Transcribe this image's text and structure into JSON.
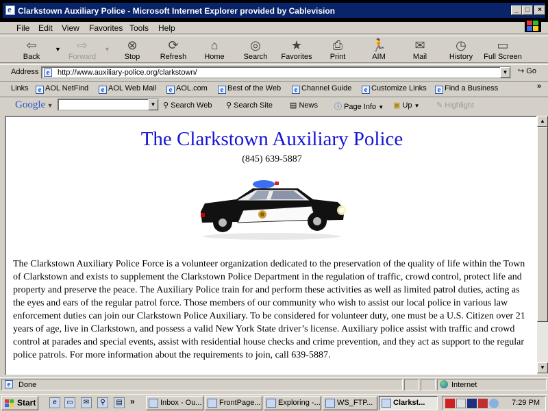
{
  "window": {
    "title": "Clarkstown Auxiliary Police - Microsoft Internet Explorer provided by Cablevision"
  },
  "menu": {
    "items": [
      "File",
      "Edit",
      "View",
      "Favorites",
      "Tools",
      "Help"
    ]
  },
  "toolbar": {
    "buttons": [
      "Back",
      "Forward",
      "Stop",
      "Refresh",
      "Home",
      "Search",
      "Favorites",
      "Print",
      "AIM",
      "Mail",
      "History",
      "Full Screen"
    ]
  },
  "address": {
    "label": "Address",
    "url": "http://www.auxiliary-police.org/clarkstown/",
    "go_label": "Go"
  },
  "links": {
    "label": "Links",
    "items": [
      "AOL NetFind",
      "AOL Web Mail",
      "AOL.com",
      "Best of the Web",
      "Channel Guide",
      "Customize Links",
      "Find a Business"
    ]
  },
  "google_bar": {
    "logo": "Google",
    "search_web": "Search Web",
    "search_site": "Search Site",
    "news": "News",
    "page_info": "Page Info",
    "up": "Up",
    "highlight": "Highlight"
  },
  "page": {
    "heading": "The Clarkstown Auxiliary Police",
    "phone": "(845) 639-5887",
    "body": "The Clarkstown Auxiliary Police Force is a volunteer organization dedicated to the preservation of the quality of life within the Town of Clarkstown and exists to supplement the Clarkstown Police Department in the regulation of traffic, crowd control, protect life and property and preserve the peace. The Auxiliary Police train for and perform these activities as well as limited patrol duties, acting as the eyes and ears of the regular patrol force. Those members of our community who wish to assist our local police in various law enforcement duties can join our Clarkstown Police Auxiliary. To be considered for volunteer duty, one must be a U.S. Citizen over 21 years of age, live in Clarkstown, and possess a valid New York State driver’s license. Auxiliary police assist with traffic and crowd control at parades and special events, assist with residential house checks and crime prevention, and they act as support to the regular police patrols. For more information about the requirements to join, call 639-5887."
  },
  "status": {
    "text": "Done",
    "zone": "Internet"
  },
  "taskbar": {
    "start": "Start",
    "tasks": [
      "Inbox - Ou...",
      "FrontPage...",
      "Exploring -...",
      "WS_FTP...",
      "Clarkst..."
    ],
    "clock": "7:29 PM"
  }
}
